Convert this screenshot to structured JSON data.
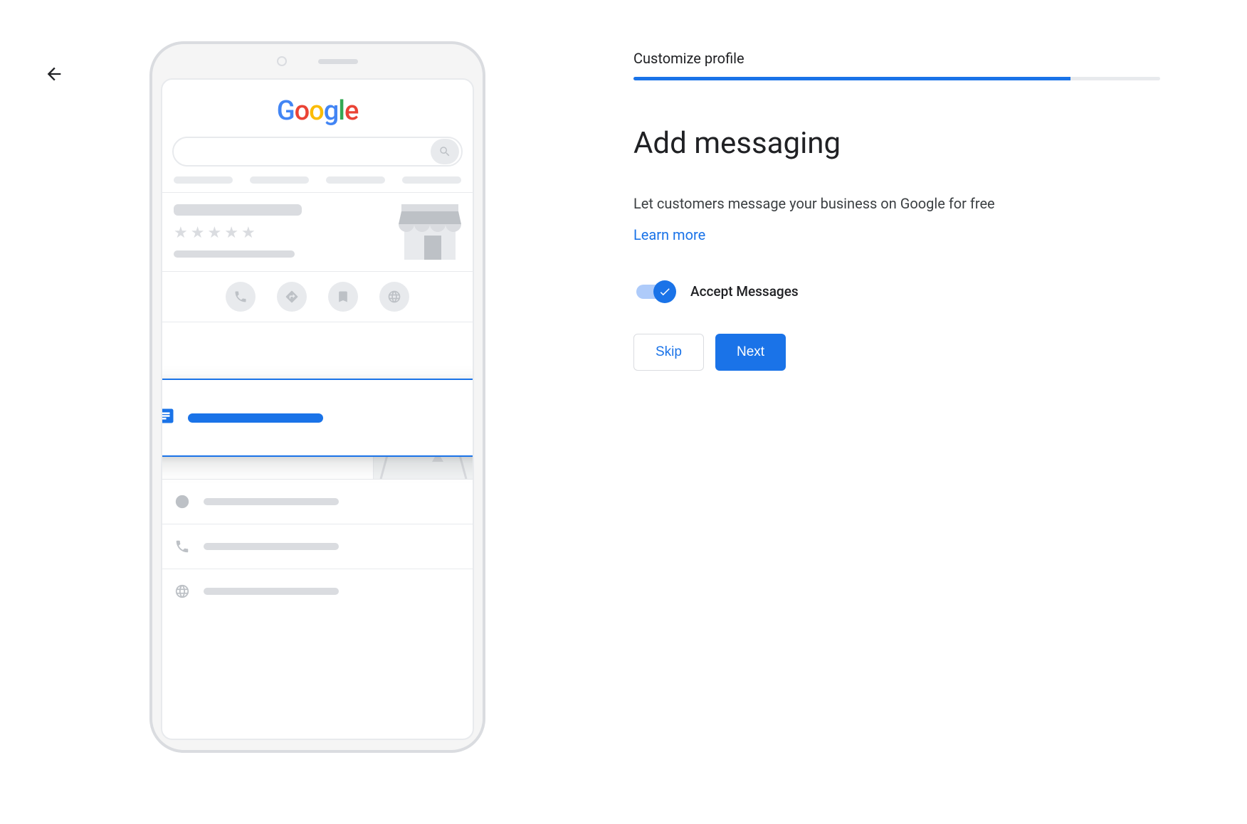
{
  "step": {
    "label": "Customize profile",
    "progress_pct": 83
  },
  "headline": "Add messaging",
  "body": "Let customers message your business on Google for free",
  "learn_more": "Learn more",
  "toggle": {
    "label": "Accept Messages",
    "state": "on"
  },
  "buttons": {
    "skip": "Skip",
    "next": "Next"
  },
  "illustration": {
    "logo_letters": [
      "G",
      "o",
      "o",
      "g",
      "l",
      "e"
    ]
  }
}
